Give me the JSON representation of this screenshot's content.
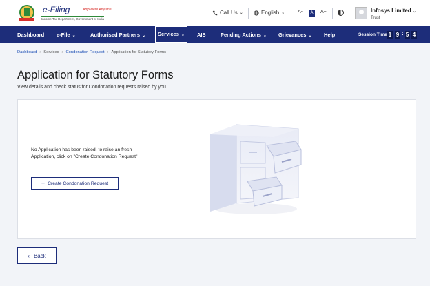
{
  "header": {
    "logo": {
      "title": "e-Filing",
      "tagline": "Anywhere Anytime",
      "subtitle": "Income Tax Department, Government of India"
    },
    "call_us": "Call Us",
    "language": "English",
    "font_buttons": [
      "A-",
      "A",
      "A+"
    ],
    "user": {
      "name": "Infosys Limited",
      "role": "Trust"
    }
  },
  "nav": {
    "items": [
      {
        "label": "Dashboard",
        "has_dropdown": false
      },
      {
        "label": "e-File",
        "has_dropdown": true
      },
      {
        "label": "Authorised Partners",
        "has_dropdown": true
      },
      {
        "label": "Services",
        "has_dropdown": true,
        "active": true
      },
      {
        "label": "AIS",
        "has_dropdown": false
      },
      {
        "label": "Pending Actions",
        "has_dropdown": true
      },
      {
        "label": "Grievances",
        "has_dropdown": true
      },
      {
        "label": "Help",
        "has_dropdown": false
      }
    ],
    "session_label": "Session Time",
    "session_digits": [
      "1",
      "9",
      "5",
      "4"
    ]
  },
  "breadcrumb": [
    "Dashboard",
    "Services",
    "Condonation Request",
    "Application for Statutory Forms"
  ],
  "page": {
    "title": "Application for Statutory Forms",
    "subtitle": "View details and check status for Condonation requests raised by you"
  },
  "empty_state": {
    "message": "No Application has been raised, to raise an fresh Application, click on \"Create Condonation Request\"",
    "create_button": "Create Condonation Request"
  },
  "back_button": "Back",
  "colors": {
    "primary": "#1d2d7a",
    "link": "#1d4fb5",
    "background": "#f2f4f8"
  }
}
